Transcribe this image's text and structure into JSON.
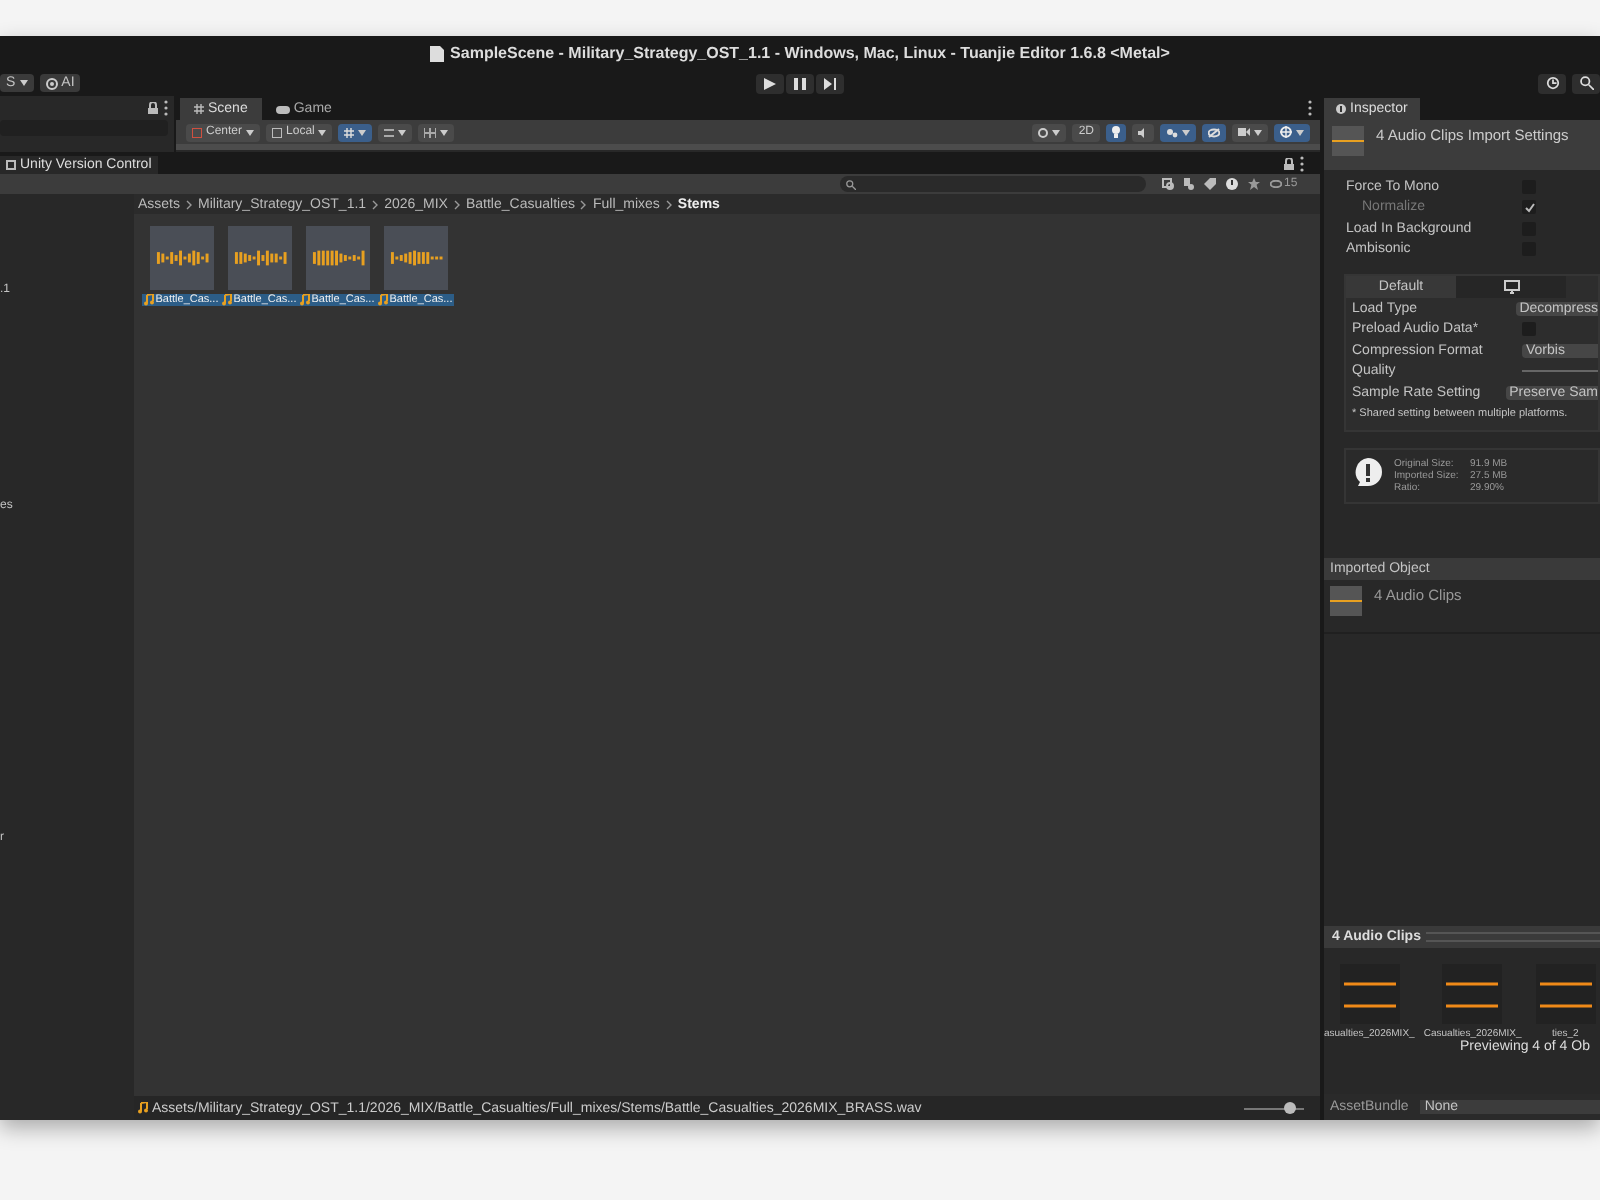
{
  "window": {
    "title": "SampleScene - Military_Strategy_OST_1.1 - Windows, Mac, Linux - Tuanjie Editor 1.6.8 <Metal>"
  },
  "toolbar": {
    "account": "S",
    "ai": "AI"
  },
  "scene_tabs": [
    {
      "label": "Scene",
      "selected": true
    },
    {
      "label": "Game",
      "selected": false
    }
  ],
  "scene_toolbar": {
    "pivot": "Center",
    "space": "Local",
    "mode": "2D",
    "lighting_on": true
  },
  "project": {
    "version_control": "Unity Version Control",
    "hidden_count": "15",
    "tree": [
      {
        "label": ".1",
        "selected": false
      },
      {
        "label": "es",
        "selected": false
      },
      {
        "label": "r",
        "selected": false
      }
    ],
    "breadcrumb": [
      {
        "label": "Assets",
        "current": false
      },
      {
        "label": "Military_Strategy_OST_1.1",
        "current": false
      },
      {
        "label": "2026_MIX",
        "current": false
      },
      {
        "label": "Battle_Casualties",
        "current": false
      },
      {
        "label": "Full_mixes",
        "current": false
      },
      {
        "label": "Stems",
        "current": true
      }
    ],
    "assets": [
      {
        "label": "Battle_Cas...",
        "selected": true
      },
      {
        "label": "Battle_Cas...",
        "selected": true
      },
      {
        "label": "Battle_Cas...",
        "selected": true
      },
      {
        "label": "Battle_Cas...",
        "selected": true
      }
    ],
    "status_path": "Assets/Military_Strategy_OST_1.1/2026_MIX/Battle_Casualties/Full_mixes/Stems/Battle_Casualties_2026MIX_BRASS.wav",
    "zoom": {
      "level": 0.75
    }
  },
  "inspector": {
    "tab": "Inspector",
    "header": "4 Audio Clips Import Settings",
    "options": [
      {
        "label": "Force To Mono",
        "checked": false,
        "disabled": false
      },
      {
        "label": "Normalize",
        "checked": true,
        "disabled": true
      },
      {
        "label": "Load In Background",
        "checked": false,
        "disabled": false
      },
      {
        "label": "Ambisonic",
        "checked": false,
        "disabled": false
      }
    ],
    "platform_tabs": [
      {
        "label": "Default",
        "selected": true
      },
      {
        "selected": false
      }
    ],
    "settings": [
      {
        "kind": "dropdown",
        "label": "Load Type",
        "value": "Decompress"
      },
      {
        "kind": "checkbox",
        "label": "Preload Audio Data*",
        "checked": false
      },
      {
        "kind": "dropdown",
        "label": "Compression Format",
        "value": "Vorbis"
      },
      {
        "kind": "slider",
        "label": "Quality"
      },
      {
        "kind": "dropdown",
        "label": "Sample Rate Setting",
        "value": "Preserve Sam"
      }
    ],
    "note": "* Shared setting between multiple platforms.",
    "info": [
      {
        "label": "Original Size:",
        "value": "91.9 MB"
      },
      {
        "label": "Imported Size:",
        "value": "27.5 MB"
      },
      {
        "label": "Ratio:",
        "value": "29.90%"
      }
    ],
    "imported_object": {
      "header": "Imported Object",
      "label": "4 Audio Clips"
    },
    "preview": {
      "title": "4 Audio Clips",
      "clips": [
        "asualties_2026MIX_",
        "Casualties_2026MIX_",
        "ties_2"
      ],
      "caption": "Previewing 4 of 4 Ob"
    },
    "asset_bundle": {
      "label": "AssetBundle",
      "value": "None"
    }
  }
}
